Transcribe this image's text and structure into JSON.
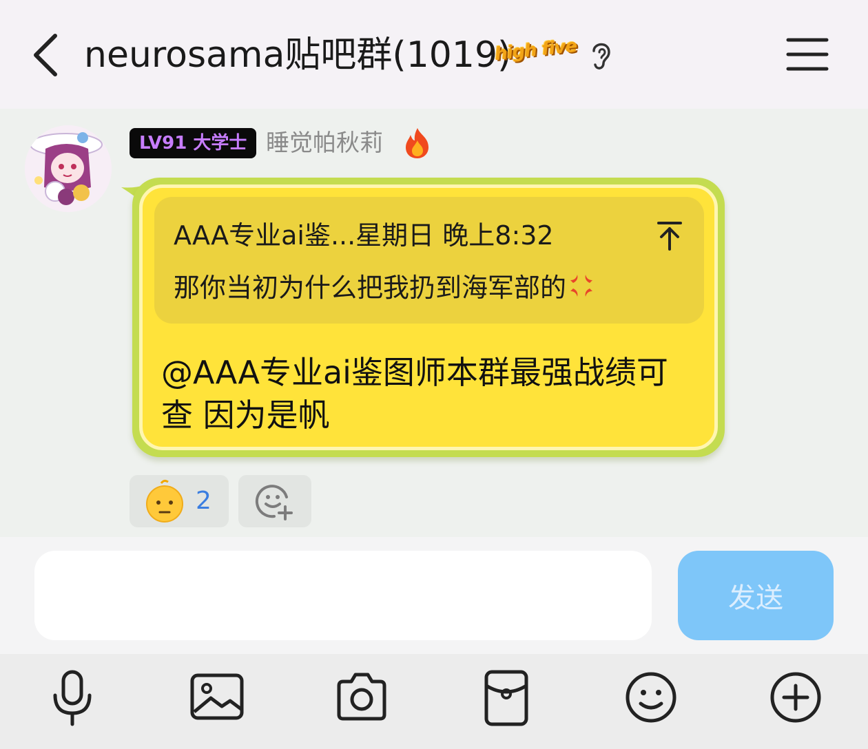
{
  "header": {
    "title": "neurosama贴吧群(1019)",
    "badge_text": "high five"
  },
  "message": {
    "level_badge": "LV91 大学士",
    "nickname": "睡觉帕秋莉",
    "quote": {
      "meta": "AAA专业ai鉴...星期日 晚上8:32",
      "text": "那你当初为什么把我扔到海军部的"
    },
    "text": "@AAA专业ai鉴图师本群最强战绩可查 因为是帆",
    "reactions": [
      {
        "emoji": "neutral-face-icon",
        "count": "2"
      }
    ]
  },
  "input": {
    "value": "",
    "placeholder": "",
    "send_label": "发送"
  },
  "toolbar": {
    "items": [
      "microphone-icon",
      "image-icon",
      "camera-icon",
      "red-packet-icon",
      "emoji-icon",
      "plus-icon"
    ]
  },
  "colors": {
    "bubble_fill": "#ffe33a",
    "bubble_border": "#c4dc50",
    "quote_fill": "#ecd23e",
    "send_button": "#7ec6f9",
    "reaction_count": "#3b7ee0",
    "level_badge_text": "#c77dff"
  }
}
